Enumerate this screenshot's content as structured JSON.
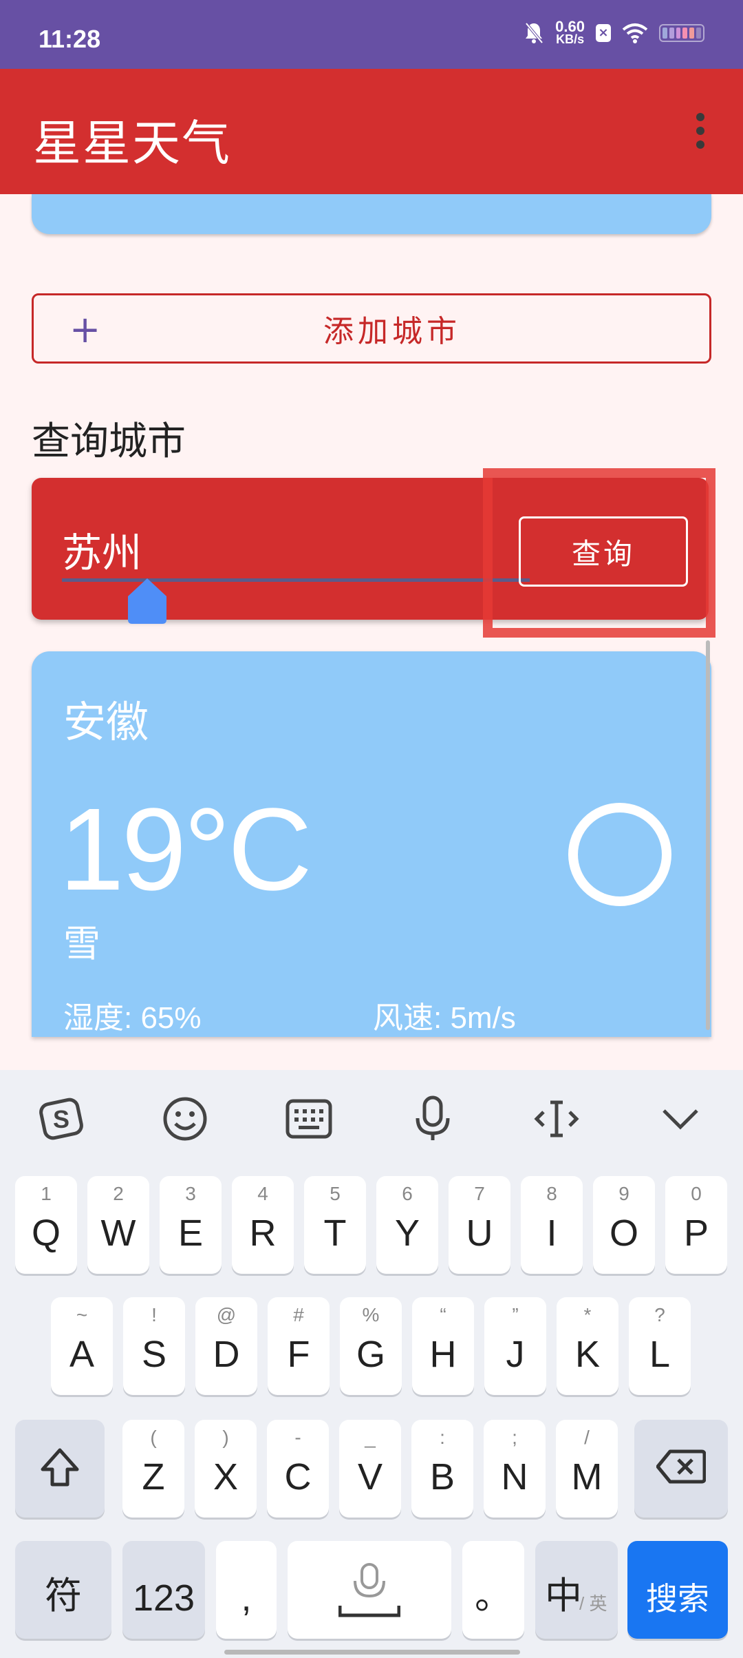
{
  "status_bar": {
    "time": "11:28",
    "net_speed_value": "0.60",
    "net_speed_unit": "KB/s",
    "icons": [
      "bell-mute-icon",
      "x-square-icon",
      "wifi-icon",
      "battery-icon"
    ]
  },
  "app_bar": {
    "title": "星星天气"
  },
  "add_city": {
    "plus": "+",
    "label": "添加城市"
  },
  "query_section": {
    "title": "查询城市",
    "input_value": "苏州",
    "button_label": "查询"
  },
  "weather_card": {
    "region": "安徽",
    "temperature": "19°C",
    "condition": "雪",
    "humidity": "湿度: 65%",
    "wind": "风速: 5m/s"
  },
  "keyboard": {
    "toolbar_icons": [
      "sogou-logo-icon",
      "emoji-icon",
      "keyboard-icon",
      "microphone-icon",
      "cursor-move-icon",
      "collapse-icon"
    ],
    "row1": [
      {
        "main": "Q",
        "sub": "1"
      },
      {
        "main": "W",
        "sub": "2"
      },
      {
        "main": "E",
        "sub": "3"
      },
      {
        "main": "R",
        "sub": "4"
      },
      {
        "main": "T",
        "sub": "5"
      },
      {
        "main": "Y",
        "sub": "6"
      },
      {
        "main": "U",
        "sub": "7"
      },
      {
        "main": "I",
        "sub": "8"
      },
      {
        "main": "O",
        "sub": "9"
      },
      {
        "main": "P",
        "sub": "0"
      }
    ],
    "row2": [
      {
        "main": "A",
        "sub": "~"
      },
      {
        "main": "S",
        "sub": "!"
      },
      {
        "main": "D",
        "sub": "@"
      },
      {
        "main": "F",
        "sub": "#"
      },
      {
        "main": "G",
        "sub": "%"
      },
      {
        "main": "H",
        "sub": "“"
      },
      {
        "main": "J",
        "sub": "”"
      },
      {
        "main": "K",
        "sub": "*"
      },
      {
        "main": "L",
        "sub": "?"
      }
    ],
    "row3": [
      {
        "main": "Z",
        "sub": "("
      },
      {
        "main": "X",
        "sub": ")"
      },
      {
        "main": "C",
        "sub": "-"
      },
      {
        "main": "V",
        "sub": "_"
      },
      {
        "main": "B",
        "sub": ":"
      },
      {
        "main": "N",
        "sub": ";"
      },
      {
        "main": "M",
        "sub": "/"
      }
    ],
    "symbols_key": "符",
    "numbers_key": "123",
    "comma_key": ",",
    "period_key": "。",
    "lang_key_main": "中",
    "lang_key_sub": "/ 英",
    "search_key": "搜索"
  }
}
